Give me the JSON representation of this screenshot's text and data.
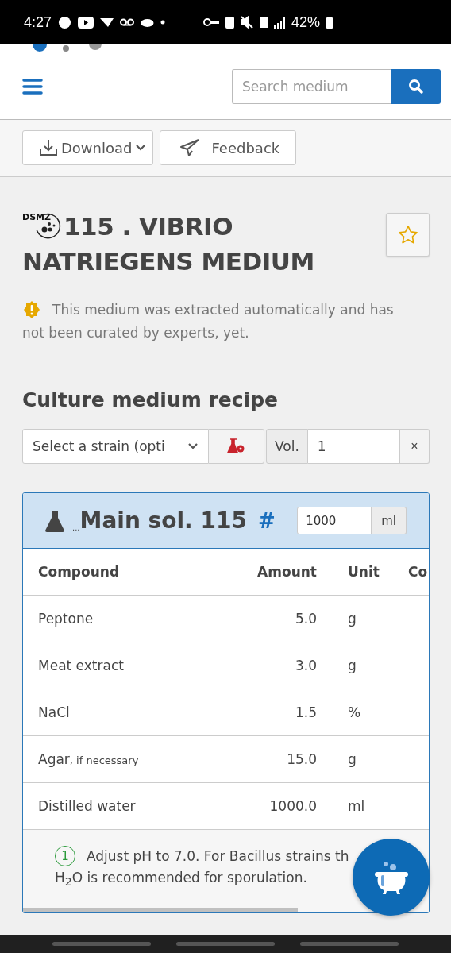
{
  "status_bar": {
    "time": "4:27",
    "battery": "42%"
  },
  "header": {
    "search": {
      "placeholder": "Search medium"
    }
  },
  "toolbar": {
    "buttons": [
      {
        "label": "Download",
        "kind": "download"
      },
      {
        "label": "Feedback",
        "kind": "feedback"
      }
    ]
  },
  "medium": {
    "logo": "DSMZ",
    "title_lines": [
      "115 . VIBRIO",
      "NATRIEGENS MEDIUM"
    ],
    "favorite": false,
    "warning_lines": [
      "This medium was extracted automatically and has",
      "not been curated by experts, yet."
    ]
  },
  "recipe": {
    "heading": "Culture medium recipe",
    "strain_select": {
      "value": "Select a strain (opti"
    },
    "volume": {
      "label": "Vol.",
      "value": "1",
      "clear": "×"
    },
    "solution": {
      "dots": "...",
      "title": "Main sol. 115",
      "anchor": "#",
      "amount": "1000",
      "unit": "ml",
      "table": {
        "columns": [
          "Compound",
          "Amount",
          "Unit",
          "Co"
        ],
        "rows": [
          {
            "compound": "Peptone",
            "amount": "5.0",
            "unit": "g"
          },
          {
            "compound": "Meat extract",
            "amount": "3.0",
            "unit": "g"
          },
          {
            "compound": "NaCl",
            "amount": "1.5",
            "unit": "%"
          },
          {
            "compound": "Agar",
            "note": ", if necessary",
            "amount": "15.0",
            "unit": "g"
          },
          {
            "compound": "Distilled water",
            "amount": "1000.0",
            "unit": "ml"
          }
        ]
      },
      "footnote": {
        "number": "1",
        "line_1": "Adjust pH to 7.0. For Bacillus strains th",
        "line_2": "H$_{2}$O is recommended for sporulation."
      }
    }
  }
}
